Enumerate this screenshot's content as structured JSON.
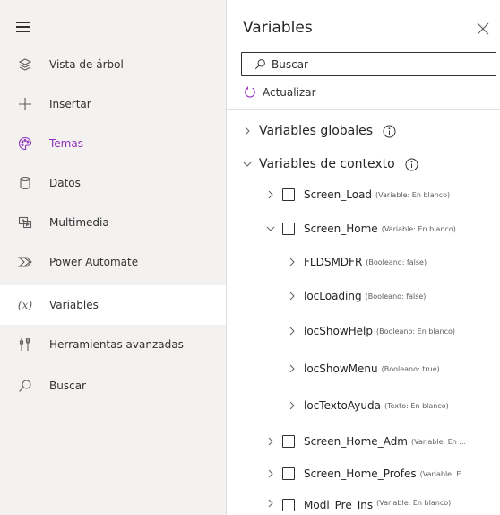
{
  "nav": {
    "items": [
      {
        "label": "Vista de árbol",
        "icon": "layers-icon"
      },
      {
        "label": "Insertar",
        "icon": "plus-icon"
      },
      {
        "label": "Temas",
        "icon": "palette-icon"
      },
      {
        "label": "Datos",
        "icon": "database-icon"
      },
      {
        "label": "Multimedia",
        "icon": "media-icon"
      },
      {
        "label": "Power Automate",
        "icon": "power-automate-icon"
      },
      {
        "label": "Variables",
        "icon": "variable-icon",
        "glyph": "(x)"
      },
      {
        "label": "Herramientas avanzadas",
        "icon": "tools-icon"
      },
      {
        "label": "Buscar",
        "icon": "search-icon"
      }
    ],
    "selected": "Variables"
  },
  "panel": {
    "title": "Variables",
    "search_placeholder": "Buscar",
    "refresh_label": "Actualizar",
    "sections": {
      "global": "Variables globales",
      "context": "Variables de contexto"
    },
    "rows": [
      {
        "name": "Screen_Load",
        "meta": "(Variable: En blanco)",
        "expanded": false
      },
      {
        "name": "Screen_Home",
        "meta": "(Variable: En blanco)",
        "expanded": true
      },
      {
        "name": "FLDSMDFR",
        "meta": "(Booleano: false)"
      },
      {
        "name": "locLoading",
        "meta": "(Booleano: false)"
      },
      {
        "name": "locShowHelp",
        "meta": "(Booleano: En blanco)"
      },
      {
        "name": "locShowMenu",
        "meta": "(Booleano: true)"
      },
      {
        "name": "locTextoAyuda",
        "meta": "(Texto: En blanco)"
      },
      {
        "name": "Screen_Home_Adm",
        "meta": "(Variable: En ...",
        "expanded": false
      },
      {
        "name": "Screen_Home_Profes",
        "meta": "(Variable: E...",
        "expanded": false
      },
      {
        "name": "Modl_Pre_Ins",
        "meta": "(Variable: En blanco)",
        "expanded": false
      }
    ]
  },
  "colors": {
    "nav_bg": "#f3f2f1",
    "accent": "#8d2fb8",
    "border": "#e1dfdd"
  }
}
